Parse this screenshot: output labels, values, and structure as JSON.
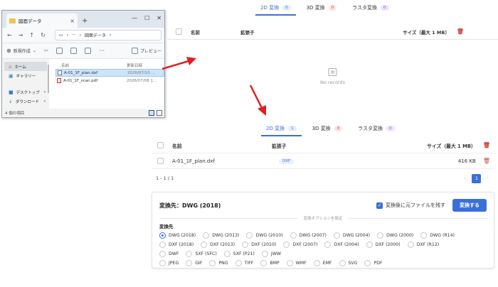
{
  "explorer": {
    "tab_title": "図面データ",
    "path_label": "図面データ",
    "new_button": "新規作成",
    "preview_label": "プレビュー",
    "sidebar": [
      {
        "label": "ホーム",
        "active": true
      },
      {
        "label": "ギャラリー",
        "active": false
      },
      {
        "label": "デスクトップ",
        "active": false
      },
      {
        "label": "ダウンロード",
        "active": false
      }
    ],
    "columns": {
      "name": "名前",
      "modified": "更新日時"
    },
    "files": [
      {
        "name": "A-01_1F_plan.dxf",
        "modified": "2026/07/10 ...",
        "selected": true,
        "type": "dxf"
      },
      {
        "name": "A-01_1F_scan.pdf",
        "modified": "2026/07/08 1...",
        "selected": false,
        "type": "pdf"
      }
    ],
    "status": "4 個の項目"
  },
  "top": {
    "tabs": [
      {
        "label": "2D 変換",
        "count": "0",
        "color": "blue",
        "active": true
      },
      {
        "label": "3D 変換",
        "count": "0",
        "color": "red",
        "active": false
      },
      {
        "label": "ラスタ変換",
        "count": "0",
        "color": "purple",
        "active": false
      }
    ],
    "header": {
      "name": "名前",
      "ext": "拡張子",
      "size": "サイズ（最大 1 MB）"
    },
    "empty_text": "No records"
  },
  "bottom": {
    "tabs": [
      {
        "label": "2D 変換",
        "count": "1",
        "color": "blue",
        "active": true
      },
      {
        "label": "3D 変換",
        "count": "0",
        "color": "red",
        "active": false
      },
      {
        "label": "ラスタ変換",
        "count": "0",
        "color": "purple",
        "active": false
      }
    ],
    "header": {
      "name": "名前",
      "ext": "拡張子",
      "size": "サイズ（最大 1 MB）"
    },
    "rows": [
      {
        "name": "A-01_1F_plan.dxf",
        "ext": "DXF",
        "size": "416 KB"
      }
    ],
    "pager": {
      "range": "1 - 1 / 1",
      "current": "1",
      "prev": "‹",
      "next": "›"
    },
    "card": {
      "title": "変換先：DWG (2018)",
      "keep_label": "変換後に元ファイルを残す",
      "convert_button": "変換する",
      "divider_text": "変換オプションを設定",
      "dest_label": "変換先",
      "options": [
        [
          "DWG (2018)",
          "DWG (2013)",
          "DWG (2010)",
          "DWG (2007)",
          "DWG (2004)",
          "DWG (2000)",
          "DWG (R14)"
        ],
        [
          "DXF (2018)",
          "DXF (2013)",
          "DXF (2010)",
          "DXF (2007)",
          "DXF (2004)",
          "DXF (2000)",
          "DXF (R12)"
        ],
        [
          "DWF",
          "SXF (SFC)",
          "SXF (P21)",
          "JWW"
        ],
        [
          "JPEG",
          "GIF",
          "PNG",
          "TIFF",
          "BMP",
          "WMF",
          "EMF",
          "SVG",
          "PDF"
        ]
      ],
      "selected": "DWG (2018)"
    }
  },
  "colors": {
    "accent": "#3b6fd8",
    "danger": "#d0453e",
    "arrow": "#e02020"
  }
}
